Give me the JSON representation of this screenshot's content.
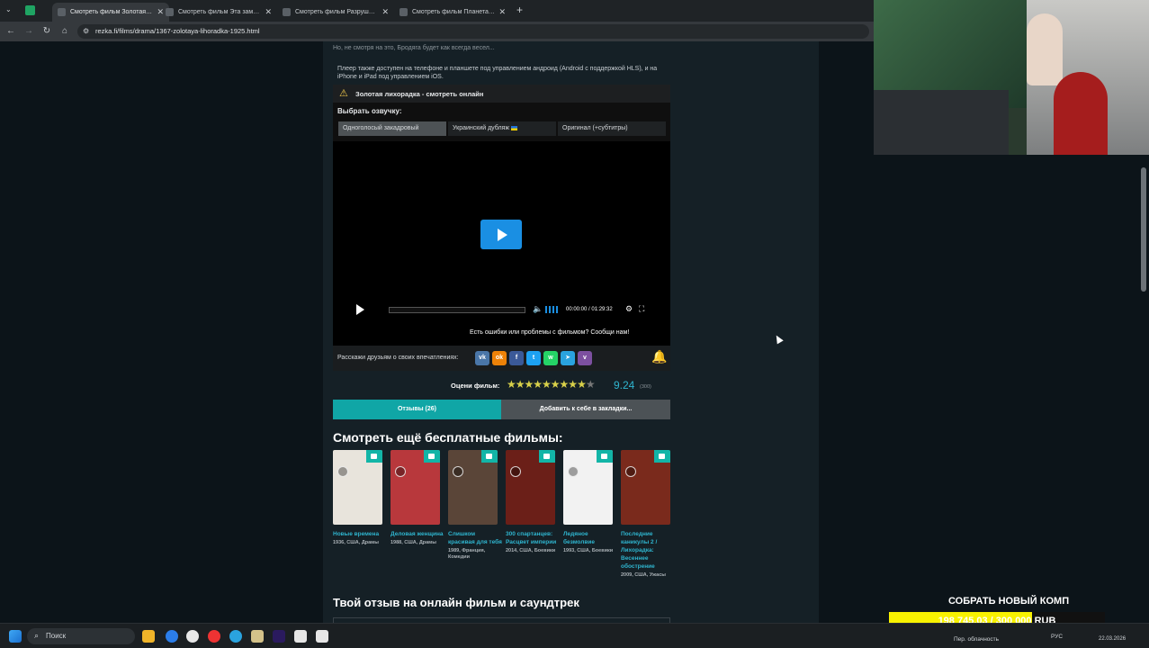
{
  "browser": {
    "tabs": [
      {
        "title": "Смотреть фильм Золотая лих",
        "active": true
      },
      {
        "title": "Смотреть фильм Эта замечате",
        "active": false
      },
      {
        "title": "Смотреть фильм Разрушител",
        "active": false
      },
      {
        "title": "Смотреть фильм Планета обе",
        "active": false
      }
    ],
    "new_tab": "+",
    "url": "rezka.fi/films/drama/1367-zolotaya-lihoradka-1925.html"
  },
  "page": {
    "top_snippet": "Но, не смотря на это, Бродяга будет как всегда весел...",
    "player_note": "Плеер также доступен на телефоне и планшете под управлением андроид (Android с поддержкой HLS), и на iPhone и iPad под управлением iOS.",
    "player_title": "Золотая лихорадка - смотреть онлайн",
    "voice_label": "Выбрать озвучку:",
    "voices": [
      "Одноголосый закадровый",
      "Украинский дубляж",
      "Оригинал (+субтитры)"
    ],
    "time_display": "00:00:00 / 01:29:32",
    "error_report": "Есть ошибки или проблемы с фильмом? Сообщи нам!",
    "share_label": "Расскажи друзьям о своих впечатлениях:",
    "share_icons": [
      "vk-icon",
      "ok-icon",
      "facebook-icon",
      "twitter-icon",
      "whatsapp-icon",
      "telegram-icon",
      "viber-icon"
    ],
    "rating_label": "Оцени фильм:",
    "rating_value": "9.24",
    "rating_stars": 10,
    "rating_count": "(300)",
    "reviews_button": "Отзывы (26)",
    "bookmark_button": "Добавить к себе в закладки...",
    "more_heading": "Смотреть ещё бесплатные фильмы:",
    "movies": [
      {
        "title": "Новые времена",
        "meta": "1936, США, Драмы",
        "color": "#e8e4dc"
      },
      {
        "title": "Деловая женщина",
        "meta": "1988, США, Драмы",
        "color": "#b8383c"
      },
      {
        "title": "Слишком красивая для тебя",
        "meta": "1989, Франция, Комедии",
        "color": "#5a4538"
      },
      {
        "title": "300 спартанцев: Расцвет империи",
        "meta": "2014, США, Боевики",
        "color": "#6b1f18"
      },
      {
        "title": "Ледяное безмолвие",
        "meta": "1993, США, Боевики",
        "color": "#f2f2f2"
      },
      {
        "title": "Последние каникулы 2 / Лихорадка: Весеннее обострение",
        "meta": "2009, США, Ужасы",
        "color": "#7a2a1c"
      }
    ],
    "review_heading": "Твой отзыв на онлайн фильм и саундтрек"
  },
  "overlay": {
    "goal_title": "СОБРАТЬ НОВЫЙ КОМП",
    "goal_amount": "198 745.03 / 300 000 RUB",
    "goal_progress": 0.6625
  },
  "taskbar": {
    "search_placeholder": "Поиск",
    "weather": "Пер. облачность",
    "lang": "РУС",
    "date": "22.03.2026"
  }
}
